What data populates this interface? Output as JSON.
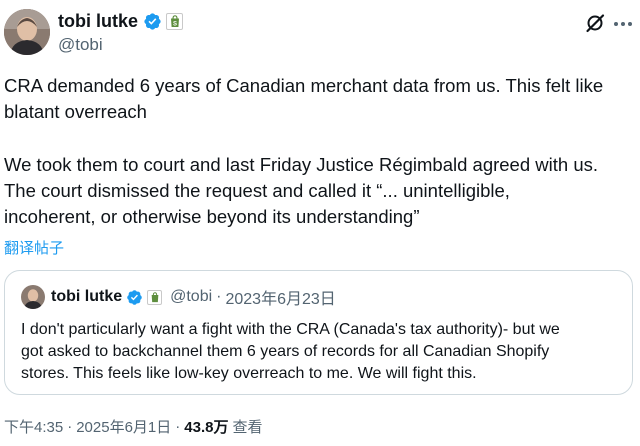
{
  "author": {
    "display_name": "tobi lutke",
    "handle": "@tobi"
  },
  "icons": {
    "verified": "verified-badge-icon",
    "brand": "shopify-bag-icon",
    "grok": "grok-icon",
    "more": "more-icon"
  },
  "colors": {
    "text_primary": "#0f1419",
    "text_secondary": "#536471",
    "link": "#1d9bf0",
    "verified": "#1d9bf0",
    "brand_green": "#5e8e3e",
    "border": "#cfd9de"
  },
  "tweet": {
    "paragraph1": [
      "CRA demanded 6 years of Canadian merchant data from us. This felt like",
      "blatant overreach"
    ],
    "paragraph2": [
      "We took them to court and last Friday Justice Régimbald agreed with us.",
      "The court dismissed the request and called it “... unintelligible,",
      "incoherent, or otherwise beyond its understanding”"
    ],
    "translate_label": "翻译帖子"
  },
  "quote": {
    "display_name": "tobi lutke",
    "handle": "@tobi",
    "separator": "·",
    "date": "2023年6月23日",
    "lines": [
      "I don't particularly want a fight with the CRA (Canada's tax authority)- but we",
      "got asked to backchannel them 6 years of records for all Canadian Shopify",
      "stores. This feels like low-key overreach to me. We will fight this."
    ]
  },
  "footer": {
    "time": "下午4:35",
    "separator": "·",
    "date": "2025年6月1日",
    "views_count": "43.8万",
    "views_label": "查看"
  }
}
